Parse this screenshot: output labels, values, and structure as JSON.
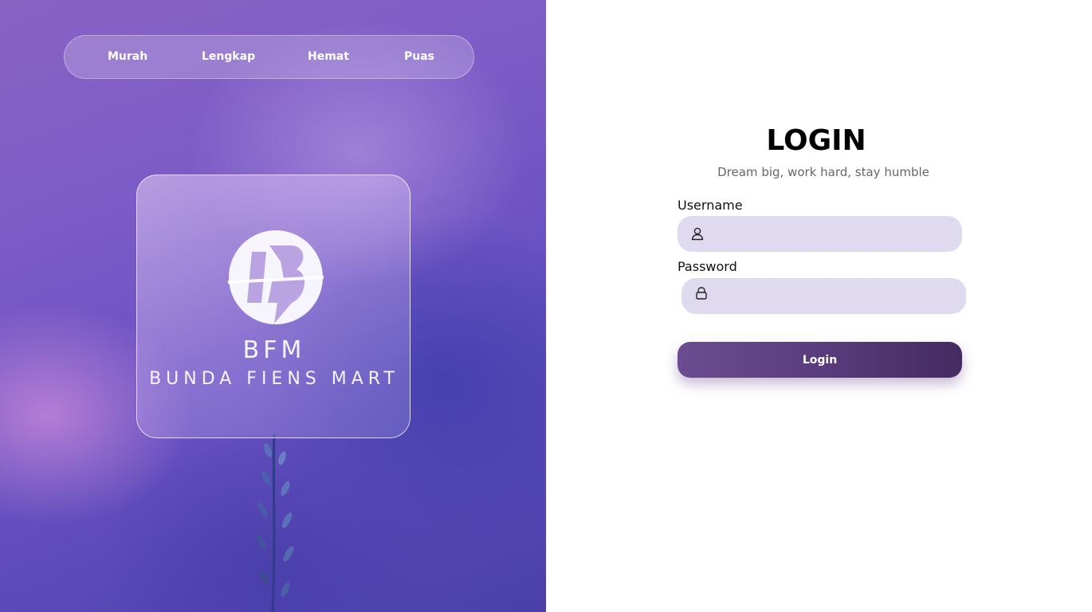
{
  "nav": {
    "items": [
      {
        "label": "Murah"
      },
      {
        "label": "Lengkap"
      },
      {
        "label": "Hemat"
      },
      {
        "label": "Puas"
      }
    ]
  },
  "brand": {
    "abbr": "BFM",
    "name": "BUNDA FIENS MART"
  },
  "login": {
    "title": "LOGIN",
    "subtitle": "Dream big, work hard, stay humble",
    "username_label": "Username",
    "username_value": "",
    "password_label": "Password",
    "password_value": "",
    "button_label": "Login"
  },
  "colors": {
    "field_bg": "#e0daf0",
    "button_bg": "#5a3c7e",
    "panel_bg": "#7c5cc6"
  },
  "icons": {
    "username": "user-icon",
    "password": "lock-icon"
  }
}
